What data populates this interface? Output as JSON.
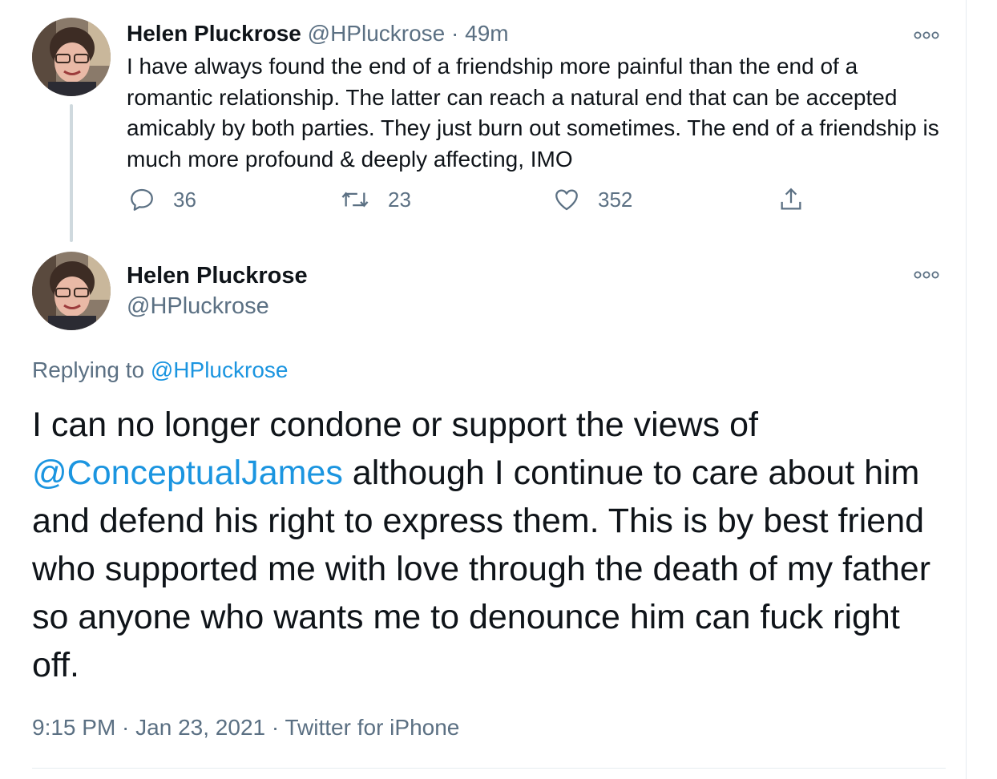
{
  "tweet_1": {
    "author_name": "Helen Pluckrose",
    "author_handle": "@HPluckrose",
    "separator": "·",
    "time_ago": "49m",
    "text": "I have always found the end of a friendship more painful than the end of a romantic relationship. The latter can reach a natural end that can be accepted amicably by both parties. They just burn out sometimes. The end of a friendship is much more profound & deeply affecting, IMO",
    "replies": "36",
    "retweets": "23",
    "likes": "352",
    "icons": [
      "more-icon",
      "reply-icon",
      "retweet-icon",
      "like-icon",
      "share-icon"
    ]
  },
  "tweet_2": {
    "author_name": "Helen Pluckrose",
    "author_handle": "@HPluckrose",
    "replying_prefix": "Replying to ",
    "replying_to": "@HPluckrose",
    "text_before_mention": "I can no longer condone or support the views of ",
    "mention": "@ConceptualJames",
    "text_after_mention": " although I continue to care about him and defend his right to express them. This is by best friend who supported me with love through the death of my father so anyone who wants me to denounce him can fuck right off.",
    "time": "9:15 PM",
    "date": "Jan 23, 2021",
    "source": "Twitter for iPhone",
    "meta_separator": " · "
  },
  "colors": {
    "text": "#0f1419",
    "muted": "#5b7083",
    "link": "#1b95e0",
    "thread_line": "#cfd9de"
  }
}
